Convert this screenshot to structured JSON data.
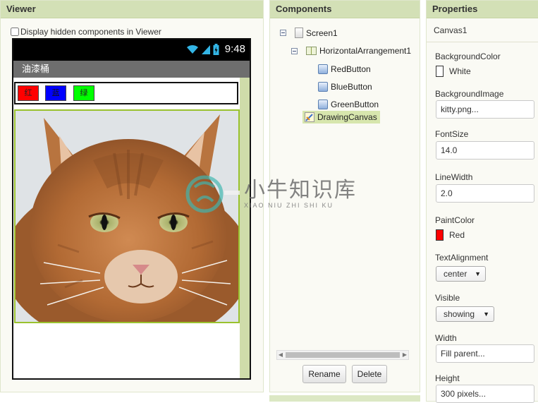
{
  "viewer": {
    "title": "Viewer",
    "hidden_checkbox_label": "Display hidden components in Viewer",
    "phone": {
      "time": "9:48",
      "app_title": "油漆桶",
      "buttons": [
        {
          "label": "红",
          "color": "#ff0000"
        },
        {
          "label": "蓝",
          "color": "#0000ff"
        },
        {
          "label": "绿",
          "color": "#00ff00"
        }
      ]
    }
  },
  "components": {
    "title": "Components",
    "tree": [
      {
        "label": "Screen1",
        "icon": "screen-icon"
      },
      {
        "label": "HorizontalArrangement1",
        "icon": "horizontal-arrangement-icon"
      },
      {
        "label": "RedButton",
        "icon": "button-icon"
      },
      {
        "label": "BlueButton",
        "icon": "button-icon"
      },
      {
        "label": "GreenButton",
        "icon": "button-icon"
      },
      {
        "label": "DrawingCanvas",
        "icon": "canvas-icon",
        "selected": true
      }
    ],
    "rename_label": "Rename",
    "delete_label": "Delete"
  },
  "properties": {
    "title": "Properties",
    "component_name": "Canvas1",
    "background_color": {
      "label": "BackgroundColor",
      "value": "White",
      "swatch": "#ffffff"
    },
    "background_image": {
      "label": "BackgroundImage",
      "value": "kitty.png..."
    },
    "font_size": {
      "label": "FontSize",
      "value": "14.0"
    },
    "line_width": {
      "label": "LineWidth",
      "value": "2.0"
    },
    "paint_color": {
      "label": "PaintColor",
      "value": "Red",
      "swatch": "#ff0000"
    },
    "text_alignment": {
      "label": "TextAlignment",
      "value": "center"
    },
    "visible": {
      "label": "Visible",
      "value": "showing"
    },
    "width": {
      "label": "Width",
      "value": "Fill parent..."
    },
    "height": {
      "label": "Height",
      "value": "300 pixels..."
    }
  },
  "watermark": {
    "chinese": "小牛知识库",
    "pinyin": "XIAO NIU ZHI SHI KU"
  },
  "colors": {
    "header_bg": "#d3e0b6",
    "canvas_border": "#9ac22e",
    "selected_bg": "#d7e6ad"
  }
}
